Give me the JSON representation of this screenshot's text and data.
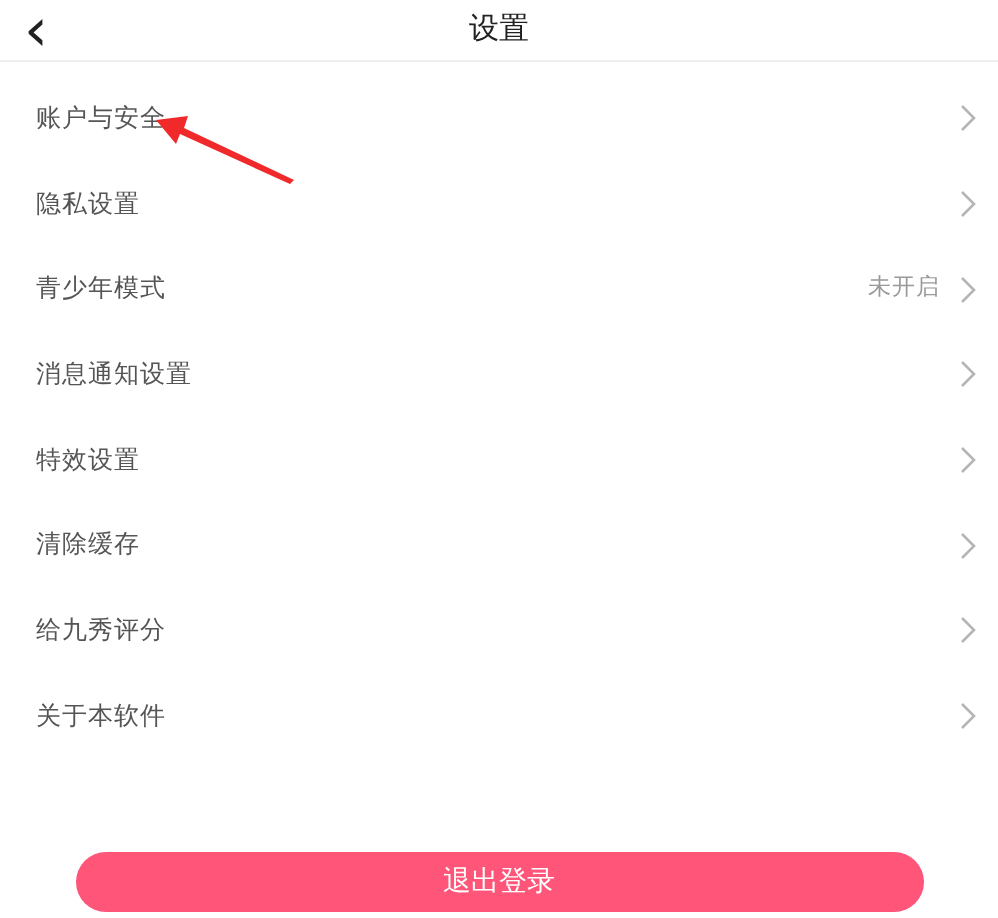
{
  "header": {
    "back": "‹",
    "title": "设置"
  },
  "items": [
    {
      "label": "账户与安全"
    },
    {
      "label": "隐私设置"
    },
    {
      "label": "青少年模式",
      "value": "未开启"
    },
    {
      "label": "消息通知设置"
    },
    {
      "label": "特效设置"
    },
    {
      "label": "清除缓存"
    },
    {
      "label": "给九秀评分"
    },
    {
      "label": "关于本软件"
    }
  ],
  "logout": "退出登录"
}
